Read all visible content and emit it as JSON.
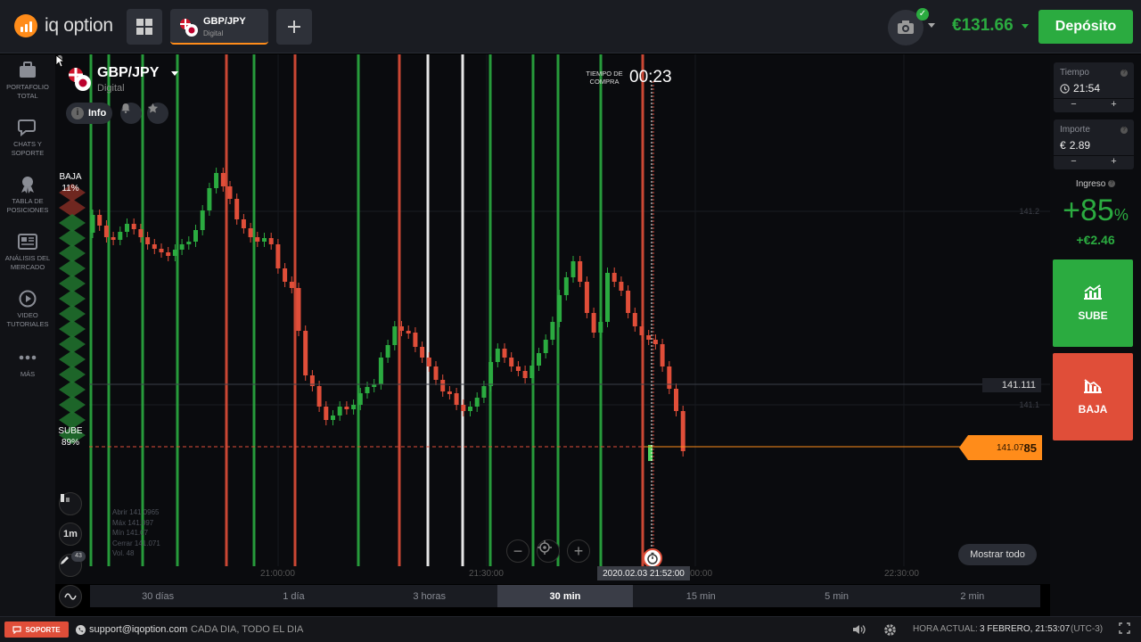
{
  "app": {
    "brand": "iq option",
    "asset_tab": {
      "name": "GBP/JPY",
      "type": "Digital"
    },
    "balance": "€131.66",
    "deposit_label": "Depósito",
    "camera_icon": "camera-icon",
    "accent_color": "#ff8c1a",
    "green": "#2bab40",
    "red": "#e04e39"
  },
  "sidebar": {
    "items": [
      {
        "label": "PORTAFOLIO TOTAL",
        "icon": "briefcase-icon"
      },
      {
        "label": "CHATS Y SOPORTE",
        "icon": "chat-icon"
      },
      {
        "label": "TABLA DE POSICIONES",
        "icon": "trophy-icon"
      },
      {
        "label": "ANÁLISIS DEL MERCADO",
        "icon": "newspaper-icon"
      },
      {
        "label": "VIDEO TUTORIALES",
        "icon": "play-icon"
      },
      {
        "label": "MÁS",
        "icon": "more-icon"
      }
    ]
  },
  "chart": {
    "asset_name": "GBP/JPY",
    "asset_type": "Digital",
    "info_label": "Info",
    "timer_label": "TIEMPO DE COMPRA",
    "timer_value": "00:23",
    "baja_label": "BAJA",
    "baja_pct": "11%",
    "sube_label": "SUBE",
    "sube_pct": "89%",
    "price_line_label": "141.111",
    "current_price_main": "141.07",
    "current_price_tail": "85",
    "ohlc": {
      "abrir": "Abrir   141.0965",
      "max": "Máx   141.097",
      "min": "Mín   141.07",
      "cerrar": "Cerrar   141.071",
      "vol": "Vol.   48"
    },
    "date_badge": "2020.02.03 21:52:00",
    "mostrar_label": "Mostrar todo",
    "drawing_count": "43",
    "interval_label": "1m"
  },
  "chart_data": {
    "type": "candlestick",
    "title": "",
    "x_ticks": [
      "21:00:00",
      "21:30:00",
      "00:00",
      "22:30:00"
    ],
    "y_ticks": [
      "141.2",
      "141.1"
    ],
    "trade_line_price": 141.111,
    "current_price": 141.0785,
    "expiry_time": "21:54"
  },
  "timeframes": {
    "items": [
      "30 días",
      "1 día",
      "3 horas",
      "30 min",
      "15 min",
      "5 min",
      "2 min"
    ],
    "active": "30 min"
  },
  "trade_panel": {
    "tiempo_label": "Tiempo",
    "tiempo_value": "21:54",
    "importe_label": "Importe",
    "importe_currency": "€",
    "importe_value": "2.89",
    "minus": "−",
    "plus": "+",
    "ingreso_label": "Ingreso",
    "ingreso_pct": "+85",
    "pct_sign": "%",
    "ingreso_value": "+€2.46",
    "sube_label": "SUBE",
    "baja_label": "BAJA"
  },
  "bottom": {
    "soporte_label": "SOPORTE",
    "email": "support@iqoption.com",
    "hours": "CADA DIA, TODO EL DIA",
    "hora_label": "HORA ACTUAL:",
    "hora_value": "3 FEBRERO, 21:53:07",
    "hora_tz": "(UTC-3)"
  }
}
